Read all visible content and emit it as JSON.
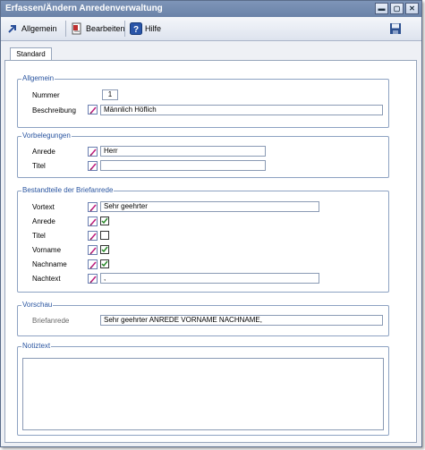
{
  "window": {
    "title": "Erfassen/Ändern Anredenverwaltung",
    "controls": [
      "minimize-icon",
      "maximize-icon",
      "close-icon"
    ]
  },
  "toolbar": {
    "items": [
      {
        "label": "Allgemein",
        "icon": "arrow-icon"
      },
      {
        "label": "Bearbeiten",
        "icon": "edit-icon"
      },
      {
        "label": "Hilfe",
        "icon": "help-icon"
      }
    ],
    "save_icon": "save-icon"
  },
  "tabs": [
    {
      "label": "Standard",
      "active": true
    }
  ],
  "groups": {
    "allgemein": {
      "title": "Allgemein",
      "nummer_label": "Nummer",
      "nummer_value": "1",
      "beschreibung_label": "Beschreibung",
      "beschreibung_value": "Männlich Höflich"
    },
    "vorbelegungen": {
      "title": "Vorbelegungen",
      "anrede_label": "Anrede",
      "anrede_value": "Herr",
      "titel_label": "Titel",
      "titel_value": ""
    },
    "bestandteile": {
      "title": "Bestandteile der Briefanrede",
      "vortext_label": "Vortext",
      "vortext_value": "Sehr geehrter",
      "anrede_label": "Anrede",
      "anrede_checked": true,
      "titel_label": "Titel",
      "titel_checked": false,
      "vorname_label": "Vorname",
      "vorname_checked": true,
      "nachname_label": "Nachname",
      "nachname_checked": true,
      "nachtext_label": "Nachtext",
      "nachtext_value": ","
    },
    "vorschau": {
      "title": "Vorschau",
      "briefanrede_label": "Briefanrede",
      "briefanrede_value": "Sehr geehrter ANREDE VORNAME NACHNAME,"
    },
    "notiztext": {
      "title": "Notiztext",
      "value": ""
    }
  },
  "colors": {
    "titlebar": "#7088ad",
    "group_title": "#2a55a0",
    "group_border": "#8da2c2",
    "check": "#2a8a2a"
  }
}
